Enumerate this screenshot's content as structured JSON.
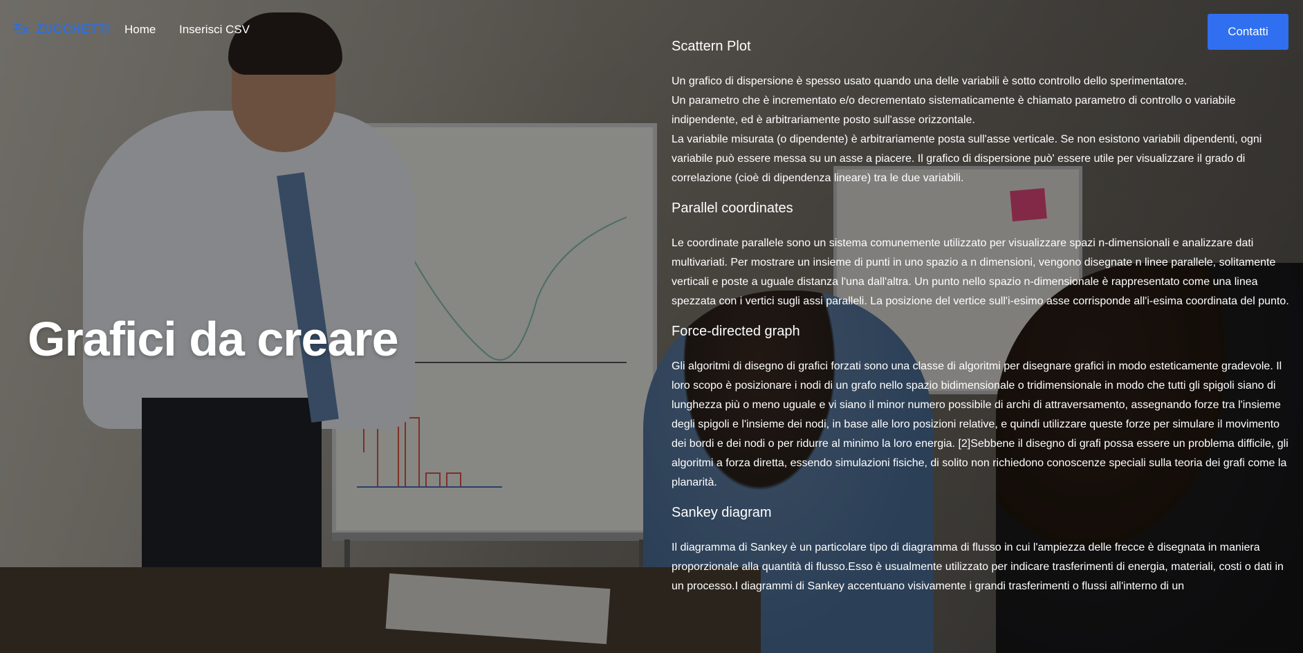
{
  "header": {
    "logo_text": "ZUCCHETTI",
    "nav": [
      {
        "label": "Home"
      },
      {
        "label": "Inserisci CSV"
      }
    ],
    "contact_label": "Contatti"
  },
  "hero": {
    "title": "Grafici da creare"
  },
  "sections": [
    {
      "title": "Scattern Plot",
      "text": "Un grafico di dispersione è spesso usato quando una delle variabili è sotto controllo dello sperimentatore.\nUn parametro che è incrementato e/o decrementato sistematicamente è chiamato parametro di controllo o variabile indipendente, ed è arbitrariamente posto sull'asse orizzontale.\nLa variabile misurata (o dipendente) è arbitrariamente posta sull'asse verticale. Se non esistono variabili dipendenti, ogni variabile può essere messa su un asse a piacere. Il grafico di dispersione può' essere utile per visualizzare il grado di correlazione (cioè di dipendenza lineare) tra le due variabili."
    },
    {
      "title": "Parallel coordinates",
      "text": "Le coordinate parallele sono un sistema comunemente utilizzato per visualizzare spazi n-dimensionali e analizzare dati multivariati. Per mostrare un insieme di punti in uno spazio a n dimensioni, vengono disegnate n linee parallele, solitamente verticali e poste a uguale distanza l'una dall'altra. Un punto nello spazio n-dimensionale è rappresentato come una linea spezzata con i vertici sugli assi paralleli. La posizione del vertice sull'i-esimo asse corrisponde all'i-esima coordinata del punto."
    },
    {
      "title": "Force-directed graph",
      "text": "Gli algoritmi di disegno di grafici forzati sono una classe di algoritmi per disegnare grafici in modo esteticamente gradevole. Il loro scopo è posizionare i nodi di un grafo nello spazio bidimensionale o tridimensionale in modo che tutti gli spigoli siano di lunghezza più o meno uguale e vi siano il minor numero possibile di archi di attraversamento, assegnando forze tra l'insieme degli spigoli e l'insieme dei nodi, in base alle loro posizioni relative, e quindi utilizzare queste forze per simulare il movimento dei bordi e dei nodi o per ridurre al minimo la loro energia. [2]Sebbene il disegno di grafi possa essere un problema difficile, gli algoritmi a forza diretta, essendo simulazioni fisiche, di solito non richiedono conoscenze speciali sulla teoria dei grafi come la planarità."
    },
    {
      "title": "Sankey diagram",
      "text": "Il diagramma di Sankey è un particolare tipo di diagramma di flusso in cui l'ampiezza delle frecce è disegnata in maniera proporzionale alla quantità di flusso.Esso è usualmente utilizzato per indicare trasferimenti di energia, materiali, costi o dati in un processo.I diagrammi di Sankey accentuano visivamente i grandi trasferimenti o flussi all'interno di un"
    }
  ],
  "colors": {
    "accent": "#2f6ff0",
    "logo": "#2f6fd6",
    "text": "#ffffff"
  }
}
